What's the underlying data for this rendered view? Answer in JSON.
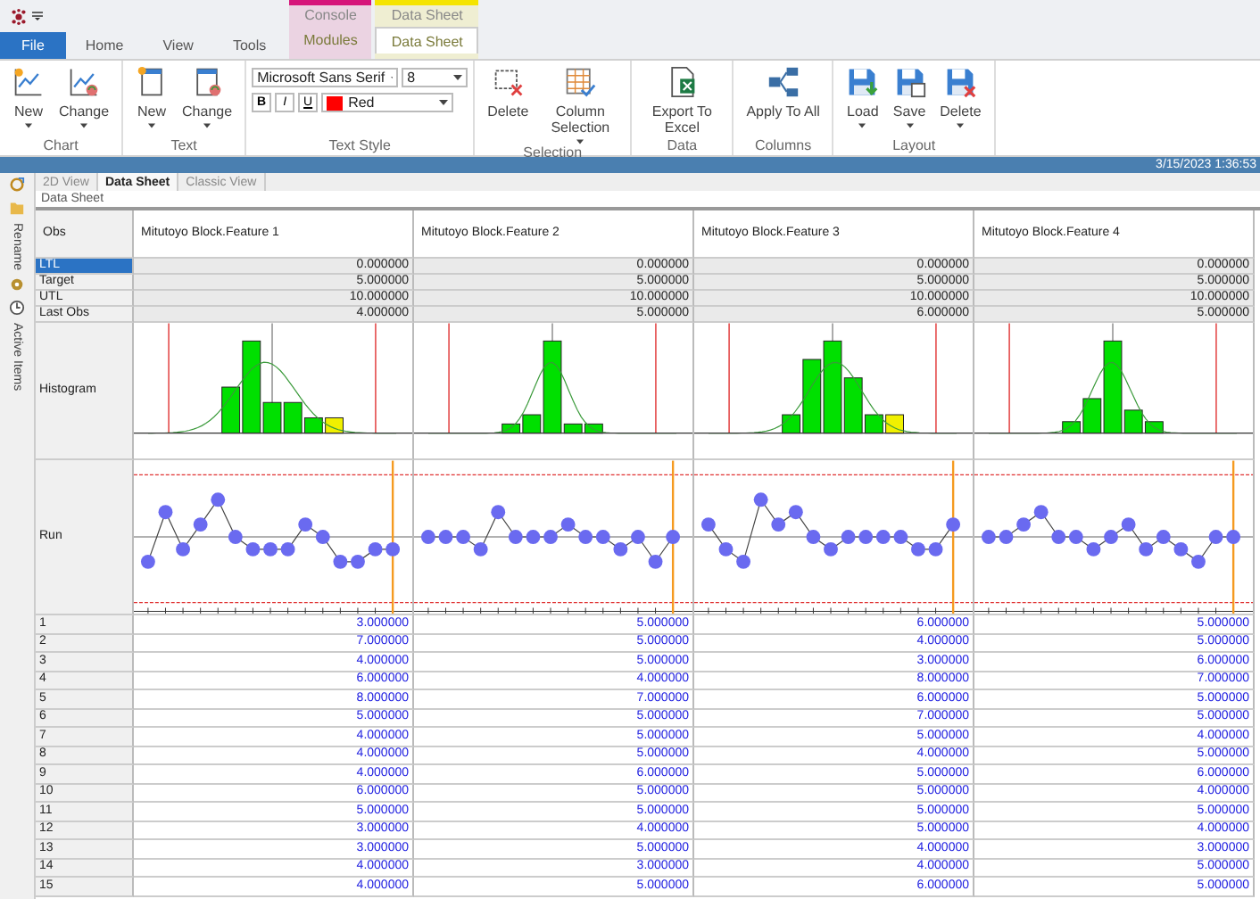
{
  "tabs": [
    {
      "label": "File",
      "kind": "file",
      "selected": false
    },
    {
      "label": "Home",
      "kind": "plain",
      "selected": false
    },
    {
      "label": "View",
      "kind": "plain",
      "selected": false
    },
    {
      "label": "Tools",
      "kind": "plain",
      "selected": false
    },
    {
      "label": "Modules",
      "kind": "context",
      "context": "Console",
      "color": "#d6157a",
      "selected": false
    },
    {
      "label": "Data Sheet",
      "kind": "context",
      "context": "Data Sheet",
      "color": "#f5e400",
      "selected": true
    }
  ],
  "ribbon_groups": [
    {
      "label": "Chart",
      "items": [
        {
          "label": "New",
          "dropdown": true
        },
        {
          "label": "Change",
          "dropdown": true
        }
      ]
    },
    {
      "label": "Text",
      "items": [
        {
          "label": "New",
          "dropdown": true
        },
        {
          "label": "Change",
          "dropdown": true
        }
      ]
    },
    {
      "label": "Text Style",
      "kind": "font",
      "font": "Microsoft Sans Serif",
      "size": "8",
      "format_buttons": [
        "B",
        "I",
        "U"
      ],
      "color_name": "Red",
      "color": "#ff0000"
    },
    {
      "label": "Selection",
      "items": [
        {
          "label": "Delete",
          "dropdown": false
        },
        {
          "label": "Column Selection",
          "dropdown": true
        }
      ]
    },
    {
      "label": "Data",
      "items": [
        {
          "label": "Export To Excel",
          "dropdown": false
        }
      ]
    },
    {
      "label": "Columns",
      "items": [
        {
          "label": "Apply To All",
          "dropdown": false
        }
      ]
    },
    {
      "label": "Layout",
      "items": [
        {
          "label": "Load",
          "dropdown": true
        },
        {
          "label": "Save",
          "dropdown": true
        },
        {
          "label": "Delete",
          "dropdown": true
        }
      ]
    }
  ],
  "status_bar": {
    "timestamp": "3/15/2023 1:36:53"
  },
  "side_panel": [
    {
      "label": "Rename"
    },
    {
      "label": "Active Items"
    }
  ],
  "view_tabs": [
    {
      "label": "2D View",
      "selected": false
    },
    {
      "label": "Data Sheet",
      "selected": true
    },
    {
      "label": "Classic View",
      "selected": false
    }
  ],
  "sheet_label": "Data Sheet",
  "grid": {
    "corner": "Obs",
    "columns": [
      "Mitutoyo Block.Feature 1",
      "Mitutoyo Block.Feature 2",
      "Mitutoyo Block.Feature 3",
      "Mitutoyo Block.Feature 4"
    ],
    "stat_rows": [
      {
        "label": "LTL",
        "selected": true,
        "values": [
          "0.000000",
          "0.000000",
          "0.000000",
          "0.000000"
        ]
      },
      {
        "label": "Target",
        "selected": false,
        "values": [
          "5.000000",
          "5.000000",
          "5.000000",
          "5.000000"
        ]
      },
      {
        "label": "UTL",
        "selected": false,
        "values": [
          "10.000000",
          "10.000000",
          "10.000000",
          "10.000000"
        ]
      },
      {
        "label": "Last Obs",
        "selected": false,
        "values": [
          "4.000000",
          "5.000000",
          "6.000000",
          "5.000000"
        ]
      }
    ],
    "chart_rows": [
      {
        "label": "Histogram",
        "kind": "histogram"
      },
      {
        "label": "Run",
        "kind": "run"
      }
    ],
    "data_rows": [
      {
        "obs": "1",
        "values": [
          "3.000000",
          "5.000000",
          "6.000000",
          "5.000000"
        ]
      },
      {
        "obs": "2",
        "values": [
          "7.000000",
          "5.000000",
          "4.000000",
          "5.000000"
        ]
      },
      {
        "obs": "3",
        "values": [
          "4.000000",
          "5.000000",
          "3.000000",
          "6.000000"
        ]
      },
      {
        "obs": "4",
        "values": [
          "6.000000",
          "4.000000",
          "8.000000",
          "7.000000"
        ]
      },
      {
        "obs": "5",
        "values": [
          "8.000000",
          "7.000000",
          "6.000000",
          "5.000000"
        ]
      },
      {
        "obs": "6",
        "values": [
          "5.000000",
          "5.000000",
          "7.000000",
          "5.000000"
        ]
      },
      {
        "obs": "7",
        "values": [
          "4.000000",
          "5.000000",
          "5.000000",
          "4.000000"
        ]
      },
      {
        "obs": "8",
        "values": [
          "4.000000",
          "5.000000",
          "4.000000",
          "5.000000"
        ]
      },
      {
        "obs": "9",
        "values": [
          "4.000000",
          "6.000000",
          "5.000000",
          "6.000000"
        ]
      },
      {
        "obs": "10",
        "values": [
          "6.000000",
          "5.000000",
          "5.000000",
          "4.000000"
        ]
      },
      {
        "obs": "11",
        "values": [
          "5.000000",
          "5.000000",
          "5.000000",
          "5.000000"
        ]
      },
      {
        "obs": "12",
        "values": [
          "3.000000",
          "4.000000",
          "5.000000",
          "4.000000"
        ]
      },
      {
        "obs": "13",
        "values": [
          "3.000000",
          "5.000000",
          "4.000000",
          "3.000000"
        ]
      },
      {
        "obs": "14",
        "values": [
          "4.000000",
          "3.000000",
          "4.000000",
          "5.000000"
        ]
      },
      {
        "obs": "15",
        "values": [
          "4.000000",
          "5.000000",
          "6.000000",
          "5.000000"
        ]
      }
    ]
  }
}
